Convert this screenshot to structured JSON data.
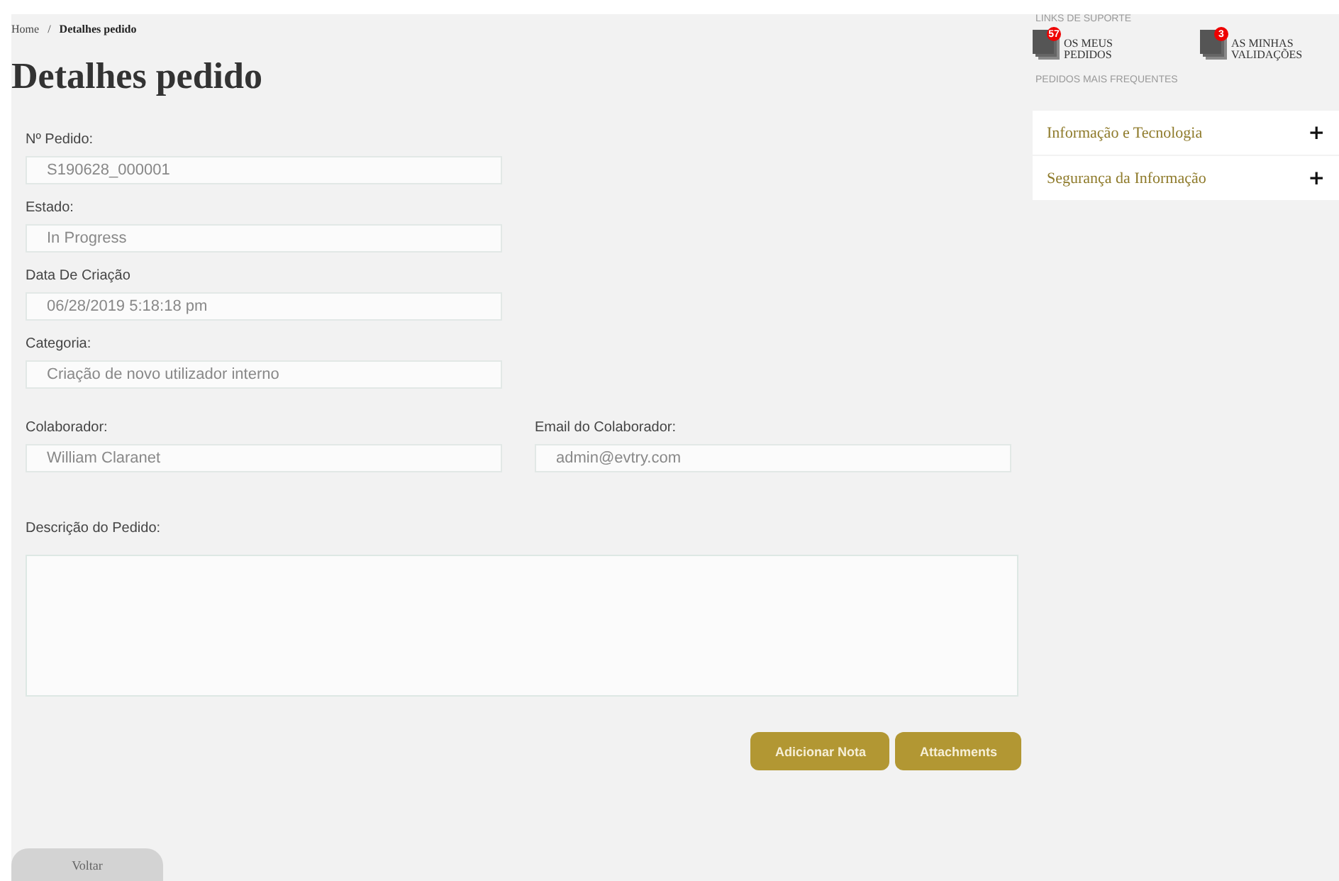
{
  "breadcrumb": {
    "items": [
      "Home",
      "Detalhes pedido"
    ],
    "separator": "/"
  },
  "title": "Detalhes pedido",
  "field_rows": [
    [
      {
        "label": "Nº Pedido:",
        "value": "S190628_000001"
      }
    ],
    [
      {
        "label": "Estado:",
        "value": "In Progress"
      }
    ],
    [
      {
        "label": "Data De Criação",
        "value": "06/28/2019 5:18:18 pm"
      }
    ],
    [
      {
        "label": "Categoria:",
        "value": "Criação de novo utilizador interno"
      }
    ],
    [
      {
        "label": "Colaborador:",
        "value": "William Claranet"
      },
      {
        "label": "Email do Colaborador:",
        "value": "admin@evtry.com"
      }
    ]
  ],
  "description": {
    "label": "Descrição do Pedido:"
  },
  "actions": [
    "Adicionar Nota",
    "Attachments"
  ],
  "back_button": "Voltar",
  "sidebar": {
    "support_heading": "LINKS DE SUPORTE",
    "support_links": [
      {
        "label": "OS MEUS PEDIDOS",
        "badge": "57"
      },
      {
        "label": "AS MINHAS VALIDAÇÕES",
        "badge": "3"
      }
    ],
    "frequent_heading": "PEDIDOS MAIS FREQUENTES",
    "categories": [
      {
        "label": "Informação e Tecnologia",
        "icon": "+",
        "expanded": false
      },
      {
        "label": "Segurança da Informação",
        "icon": "+",
        "expanded": false
      }
    ]
  }
}
